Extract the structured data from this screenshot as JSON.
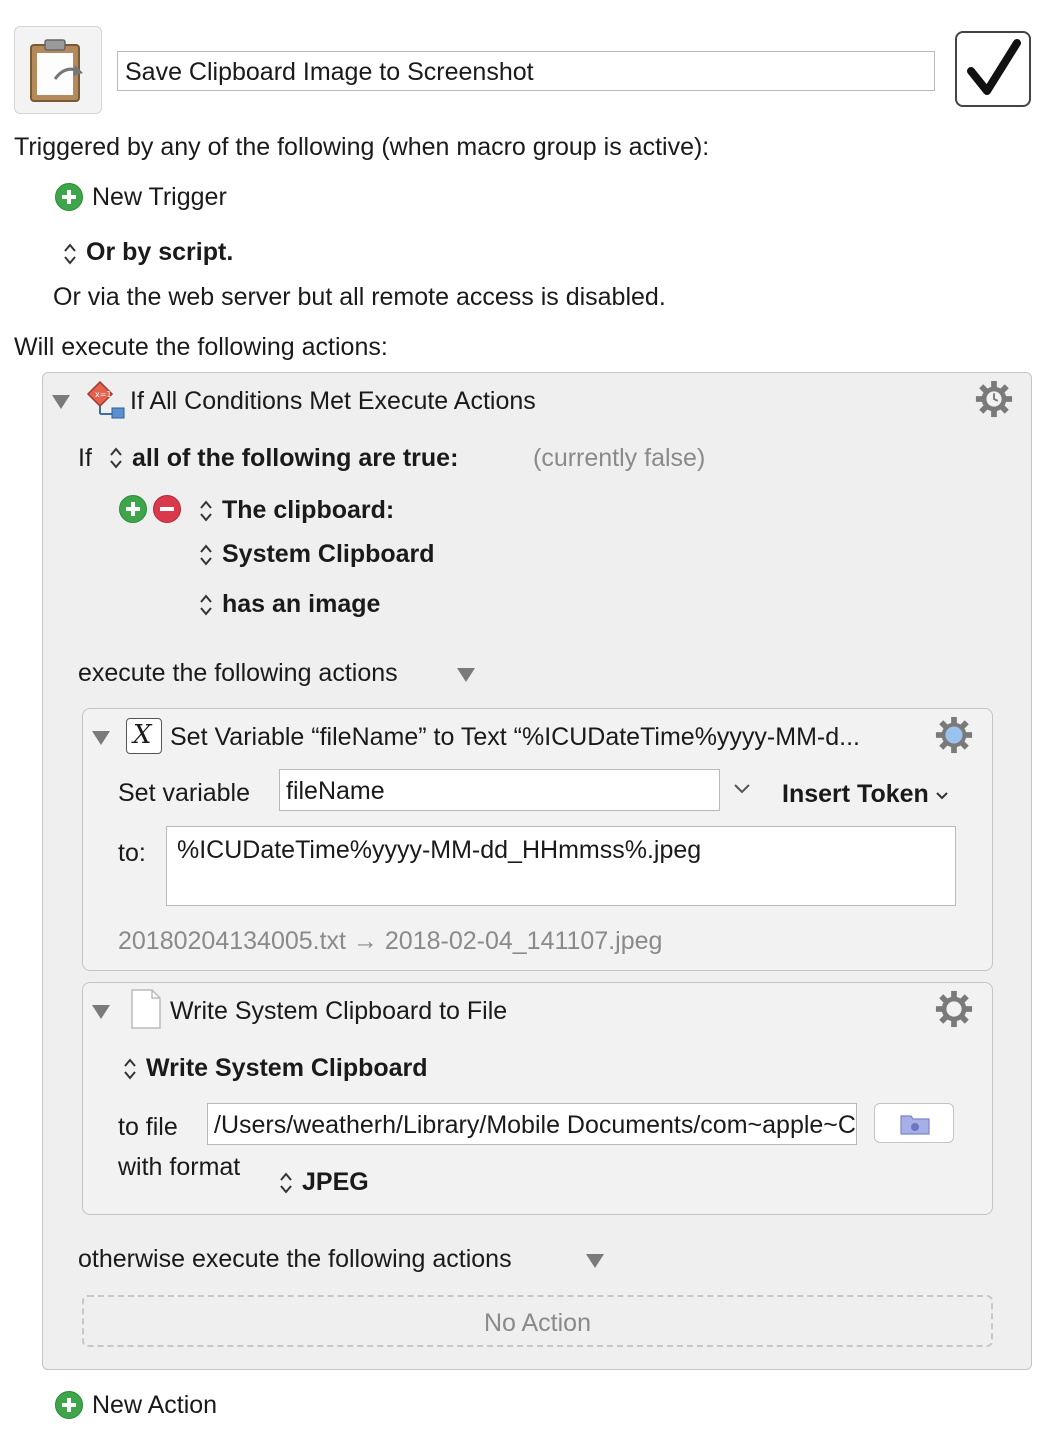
{
  "macro": {
    "title": "Save Clipboard Image to Screenshot",
    "enabled": true
  },
  "triggers": {
    "heading": "Triggered by any of the following (when macro group is active):",
    "new_trigger_label": "New Trigger",
    "or_by_script": "Or by script.",
    "web_server_note": "Or via the web server but all remote access is disabled."
  },
  "actions_heading": "Will execute the following actions:",
  "if_action": {
    "title": "If All Conditions Met Execute Actions",
    "if_label": "If",
    "condition_mode": "all of the following are true:",
    "status": "(currently false)",
    "condition": {
      "type": "The clipboard:",
      "clipboard": "System Clipboard",
      "test": "has an image"
    },
    "then_label": "execute the following actions",
    "otherwise_label": "otherwise execute the following actions",
    "no_action_label": "No Action"
  },
  "set_variable_action": {
    "title": "Set Variable “fileName” to Text “%ICUDateTime%yyyy-MM-d...",
    "set_variable_label": "Set variable",
    "variable_name": "fileName",
    "insert_token_label": "Insert Token",
    "to_label": "to:",
    "value": "%ICUDateTime%yyyy-MM-dd_HHmmss%.jpeg",
    "preview": "20180204134005.txt → 2018-02-04_141107.jpeg"
  },
  "write_clipboard_action": {
    "title": "Write System Clipboard to File",
    "source": "Write System Clipboard",
    "to_file_label": "to file",
    "path": "/Users/weatherh/Library/Mobile Documents/com~apple~CloudDocs/Screenshots",
    "format_label": "with format",
    "format": "JPEG"
  },
  "new_action_label": "New Action",
  "colors": {
    "green": "#3fa54a",
    "red": "#d9394a",
    "panel": "#efefef"
  }
}
